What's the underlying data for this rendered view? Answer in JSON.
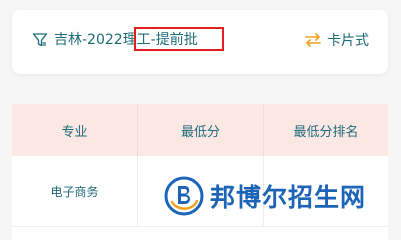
{
  "filter": {
    "province_year": "吉林-2022",
    "category": "理工-提前批",
    "view_toggle_label": "卡片式"
  },
  "table": {
    "headers": [
      "专业",
      "最低分",
      "最低分排名"
    ],
    "rows": [
      [
        "电子商务",
        "",
        ""
      ]
    ]
  },
  "watermark": {
    "text": "邦博尔招生网"
  },
  "colors": {
    "accent_teal": "#1e6b78",
    "toggle_orange": "#f0a020",
    "header_bg": "#fbe7e3",
    "highlight_red": "#e02020",
    "watermark_blue": "#1c64b8"
  },
  "icons": {
    "filter": "filter-icon",
    "switch": "swap-arrows-icon",
    "watermark_logo": "b-logo-icon"
  }
}
